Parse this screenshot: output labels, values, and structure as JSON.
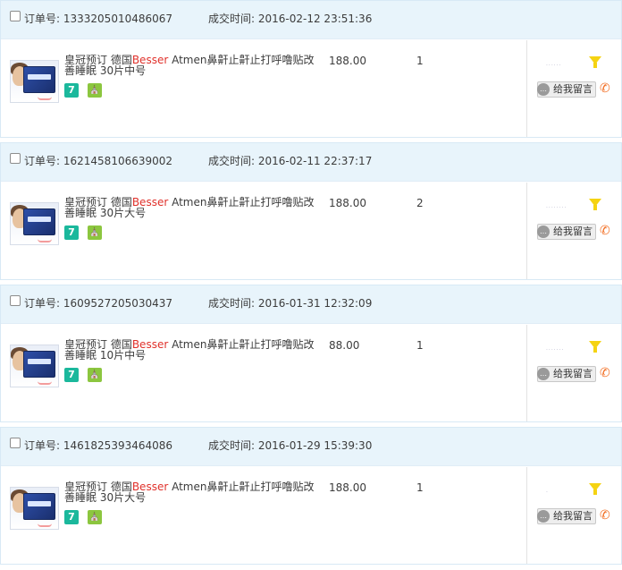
{
  "labels": {
    "order_no": "订单号:",
    "deal_time": "成交时间:",
    "leave_message": "给我留言"
  },
  "product": {
    "title_prefix": "皇冠预订 德国",
    "brand": "Besser",
    "title_middle": " Atmen鼻鼾止鼾止打呼噜贴改善睡眠 "
  },
  "colors": {
    "header_bg": "#e8f4fb",
    "brand_red": "#e0312b",
    "badge_seven": "#1bb89c",
    "badge_guard": "#8cc63f",
    "flag_yellow": "#f5d312",
    "phone_orange": "#f26d21"
  },
  "icons": {
    "badge_seven": "7",
    "badge_guard": "guard-icon",
    "flag": "flag-icon",
    "phone": "phone-icon",
    "message": "message-icon"
  },
  "orders": [
    {
      "order_number": "1333205010486067",
      "deal_time": "2016-02-12 23:51:36",
      "size": "30片中号",
      "price": "188.00",
      "quantity": "1",
      "buyer_name": "······"
    },
    {
      "order_number": "1621458106639002",
      "deal_time": "2016-02-11 22:37:17",
      "size": "30片大号",
      "price": "188.00",
      "quantity": "2",
      "buyer_name": "········"
    },
    {
      "order_number": "1609527205030437",
      "deal_time": "2016-01-31 12:32:09",
      "size": "10片中号",
      "price": "88.00",
      "quantity": "1",
      "buyer_name": "·······"
    },
    {
      "order_number": "1461825393464086",
      "deal_time": "2016-01-29 15:39:30",
      "size": "30片大号",
      "price": "188.00",
      "quantity": "1",
      "buyer_name": "·"
    }
  ]
}
